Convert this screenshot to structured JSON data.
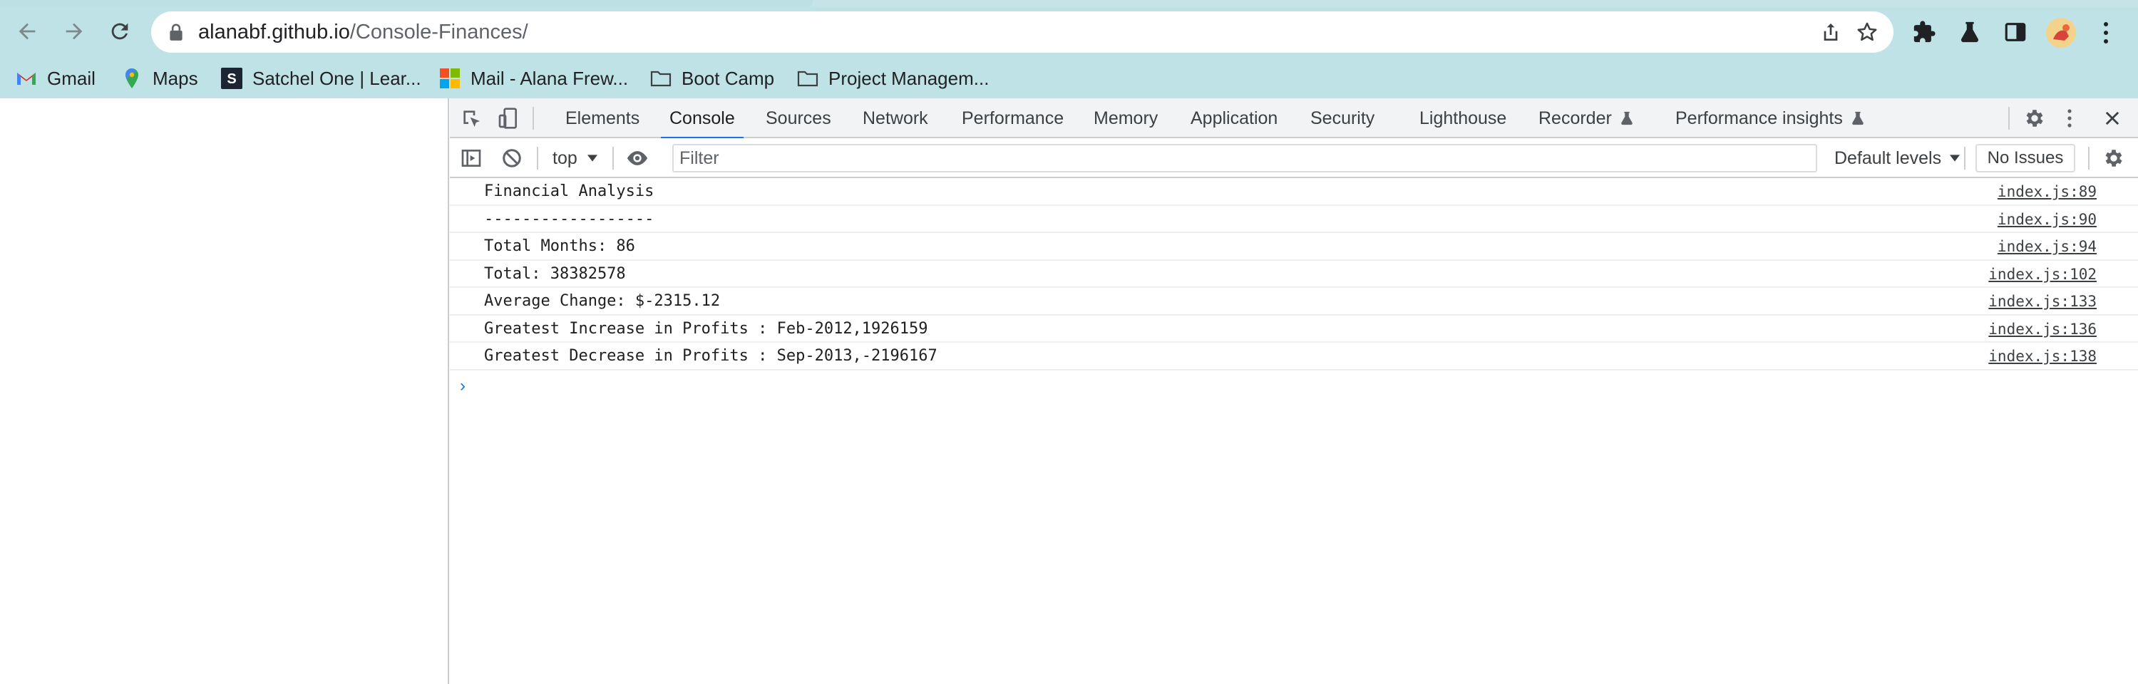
{
  "browser": {
    "url_host": "alanabf.github.io",
    "url_path": "/Console-Finances/"
  },
  "bookmarks": [
    {
      "label": "Gmail",
      "icon": "gmail-icon"
    },
    {
      "label": "Maps",
      "icon": "maps-pin-icon"
    },
    {
      "label": "Satchel One | Lear...",
      "icon": "satchel-one-icon"
    },
    {
      "label": "Mail - Alana Frew...",
      "icon": "microsoft-icon"
    },
    {
      "label": "Boot Camp",
      "icon": "folder-icon"
    },
    {
      "label": "Project Managem...",
      "icon": "folder-icon"
    }
  ],
  "devtools": {
    "tabs": [
      {
        "label": "Elements"
      },
      {
        "label": "Console",
        "active": true
      },
      {
        "label": "Sources"
      },
      {
        "label": "Network"
      },
      {
        "label": "Performance"
      },
      {
        "label": "Memory"
      },
      {
        "label": "Application"
      },
      {
        "label": "Security"
      },
      {
        "label": "Lighthouse"
      },
      {
        "label": "Recorder"
      },
      {
        "label": "Performance insights"
      }
    ],
    "console_bar": {
      "context": "top",
      "filter_placeholder": "Filter",
      "levels": "Default levels",
      "issues": "No Issues"
    },
    "log": [
      {
        "message": "Financial Analysis",
        "source": "index.js:89"
      },
      {
        "message": "------------------",
        "source": "index.js:90"
      },
      {
        "message": "Total Months: 86",
        "source": "index.js:94"
      },
      {
        "message": "Total: 38382578",
        "source": "index.js:102"
      },
      {
        "message": "Average Change: $-2315.12",
        "source": "index.js:133"
      },
      {
        "message": "Greatest Increase in Profits : Feb-2012,1926159",
        "source": "index.js:136"
      },
      {
        "message": "Greatest Decrease in Profits : Sep-2013,-2196167",
        "source": "index.js:138"
      }
    ],
    "prompt_glyph": "›"
  },
  "colors": {
    "chrome_bg": "#bfe2e6",
    "accent": "#1a73e8"
  }
}
